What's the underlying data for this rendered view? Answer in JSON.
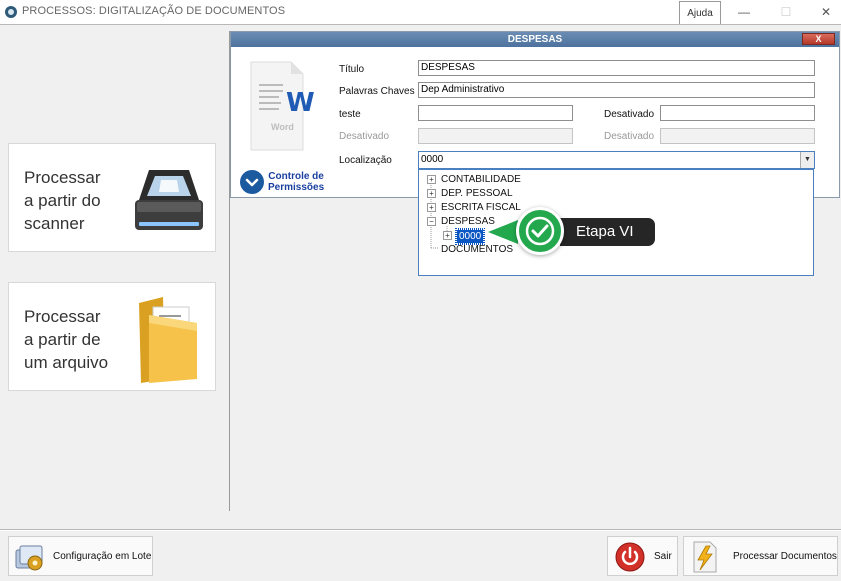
{
  "window": {
    "title": "PROCESSOS: DIGITALIZAÇÃO DE DOCUMENTOS",
    "help_label": "Ajuda",
    "minimize_glyph": "—",
    "maximize_glyph": "☐",
    "close_glyph": "✕"
  },
  "left_panel": {
    "scanner_card": {
      "line1": "Processar",
      "line2": "a partir do",
      "line3": "scanner",
      "icon": "scanner-icon"
    },
    "file_card": {
      "line1": "Processar",
      "line2": "a partir de",
      "line3": "um arquivo",
      "icon": "folder-icon"
    }
  },
  "dialog": {
    "title": "DESPESAS",
    "close_label": "X",
    "doc_icon": {
      "name": "word-document-icon",
      "letter": "W",
      "caption": "Word"
    },
    "fields": {
      "titulo": {
        "label": "Título",
        "value": "DESPESAS"
      },
      "palavras_chaves": {
        "label": "Palavras Chaves",
        "value": "Dep Administrativo"
      },
      "teste": {
        "label": "teste",
        "value": ""
      },
      "desativado_1": {
        "label": "Desativado",
        "value": ""
      },
      "desativado_2": {
        "label": "Desativado",
        "value": ""
      },
      "desativado_3": {
        "label": "Desativado",
        "value": ""
      },
      "localizacao": {
        "label": "Localização",
        "value": "0000"
      }
    },
    "permissions": {
      "line1": "Controle de",
      "line2": "Permissões"
    },
    "tree": [
      {
        "label": "CONTABILIDADE",
        "expander": "+"
      },
      {
        "label": "DEP. PESSOAL",
        "expander": "+"
      },
      {
        "label": "ESCRITA FISCAL",
        "expander": "+"
      },
      {
        "label": "DESPESAS",
        "expander": "−"
      },
      {
        "label": "0000",
        "expander": "+",
        "selected": true
      },
      {
        "label": "DOCUMENTOS",
        "expander": ""
      }
    ]
  },
  "callout": {
    "label": "Etapa VI",
    "color": "#23a84e"
  },
  "bottom": {
    "batch_config_label": "Configuração em Lote",
    "exit_label": "Sair",
    "process_label": "Processar Documentos"
  }
}
